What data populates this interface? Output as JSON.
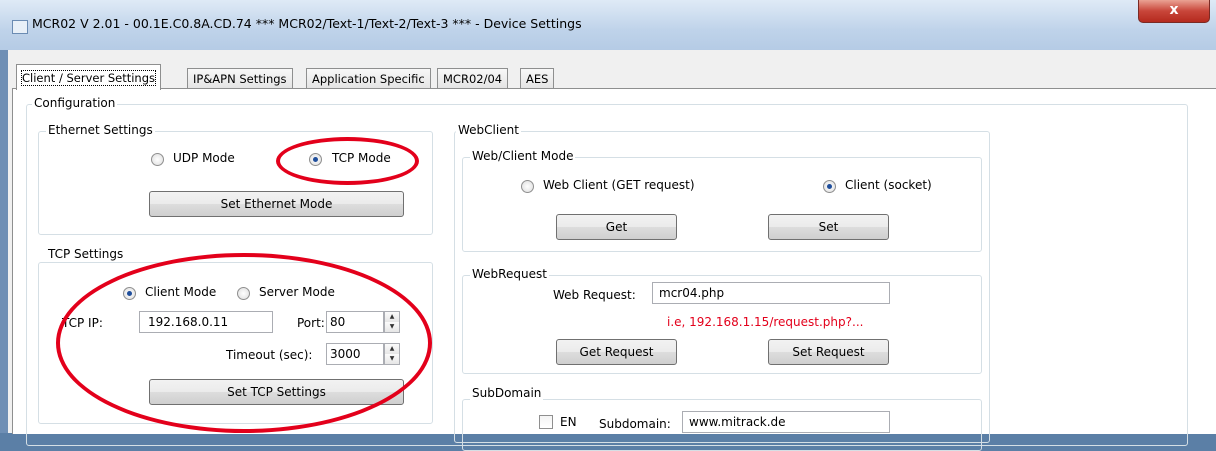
{
  "window": {
    "title": "MCR02 V 2.01 - 00.1E.C0.8A.CD.74 *** MCR02/Text-1/Text-2/Text-3 *** - Device Settings",
    "close_glyph": "x"
  },
  "tabs": [
    {
      "label": "Client / Server Settings",
      "active": true
    },
    {
      "label": "IP&APN Settings",
      "active": false
    },
    {
      "label": "Application Specific",
      "active": false
    },
    {
      "label": "MCR02/04",
      "active": false
    },
    {
      "label": "AES",
      "active": false
    }
  ],
  "configuration": {
    "label": "Configuration",
    "ethernet": {
      "label": "Ethernet Settings",
      "udp_label": "UDP Mode",
      "tcp_label": "TCP Mode",
      "selected": "TCP Mode",
      "set_button": "Set Ethernet Mode"
    },
    "tcp": {
      "label": "TCP Settings",
      "client_label": "Client Mode",
      "server_label": "Server Mode",
      "selected": "Client Mode",
      "ip_label": "TCP IP:",
      "ip_value": "192.168.0.11",
      "port_label": "Port:",
      "port_value": "80",
      "timeout_label": "Timeout (sec):",
      "timeout_value": "3000",
      "set_button": "Set TCP Settings"
    },
    "webclient": {
      "label": "WebClient",
      "mode": {
        "label": "Web/Client Mode",
        "web_label": "Web Client (GET request)",
        "client_label": "Client (socket)",
        "selected": "Client (socket)",
        "get_button": "Get",
        "set_button": "Set"
      },
      "webrequest": {
        "label": "WebRequest",
        "field_label": "Web Request:",
        "value": "mcr04.php",
        "hint": "i.e, 192.168.1.15/request.php?...",
        "get_button": "Get Request",
        "set_button": "Set Request"
      },
      "subdomain": {
        "label": "SubDomain",
        "en_label": "EN",
        "en_checked": false,
        "field_label": "Subdomain:",
        "value": "www.mitrack.de"
      }
    }
  },
  "colors": {
    "annotation": "#e3001b",
    "radio_dot": "#1f4e9b",
    "hint_text": "#e3001b"
  }
}
